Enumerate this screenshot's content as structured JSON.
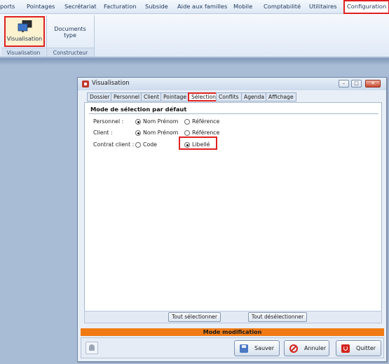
{
  "menubar": {
    "items": [
      "ports",
      "Pointages",
      "Secrétariat",
      "Facturation",
      "Subside",
      "Aide aux familles",
      "Mobile",
      "Comptabilité",
      "Utilitaires"
    ],
    "active": "Configuration"
  },
  "ribbon": {
    "buttons": {
      "visualisation": "Visualisation",
      "documents_type": "Documents type"
    },
    "groups": {
      "visualisation": "Visualisation",
      "constructeur": "Constructeur"
    }
  },
  "dialog": {
    "title": "Visualisation",
    "tabs": [
      "Dossier",
      "Personnel",
      "Client",
      "Pointage",
      "Sélection",
      "Conflits",
      "Agenda",
      "Affichage"
    ],
    "active_tab": "Sélection",
    "section_title": "Mode de sélection par défaut",
    "rows": [
      {
        "label": "Personnel :",
        "options": [
          "Nom Prénom",
          "Référence"
        ],
        "selected": "Nom Prénom"
      },
      {
        "label": "Client :",
        "options": [
          "Nom Prénom",
          "Référence"
        ],
        "selected": "Nom Prénom"
      },
      {
        "label": "Contrat client :",
        "options": [
          "Code",
          "Libellé"
        ],
        "selected": "Libellé"
      }
    ],
    "select_all": "Tout sélectionner",
    "deselect_all": "Tout désélectionner",
    "mode_text": "Mode modification",
    "buttons": {
      "save": "Sauver",
      "cancel": "Annuler",
      "quit": "Quitter"
    }
  },
  "colors": {
    "highlight": "#e02020",
    "mode_bar": "#f07a14",
    "window_bg": "#a9bcd6"
  }
}
